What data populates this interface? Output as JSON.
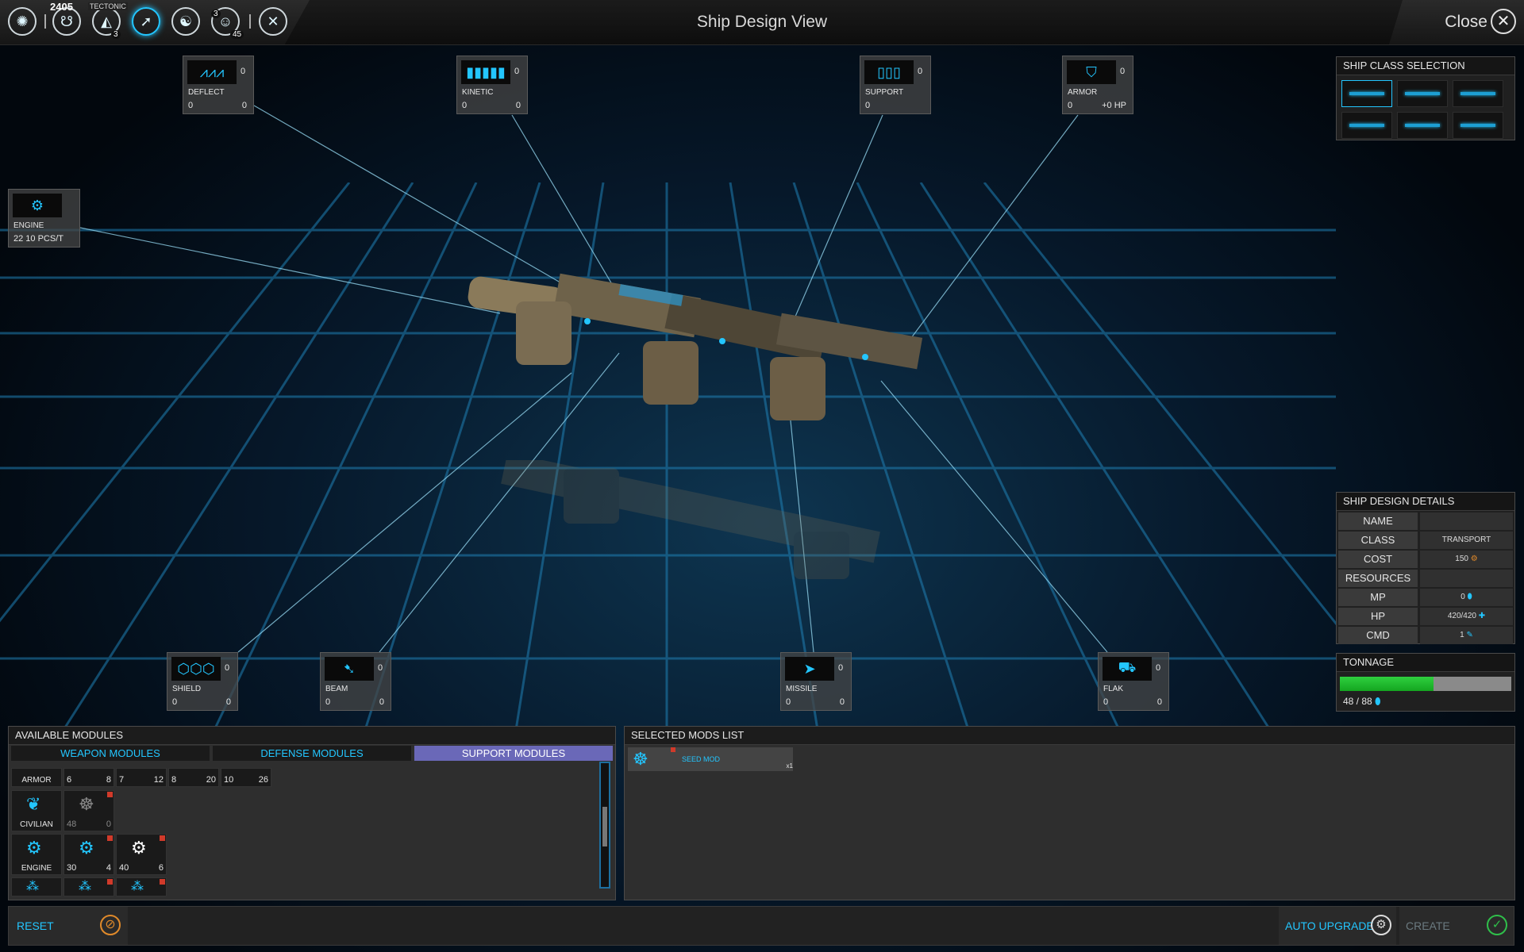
{
  "topbar": {
    "title": "Ship Design View",
    "credits": "2405",
    "planet_label": "TECTONIC",
    "badge_1": "3",
    "badge_2": "3",
    "badge_3": "45",
    "close_label": "Close"
  },
  "slots": {
    "deflect": {
      "name": "DEFLECT",
      "count": "0",
      "stat1": "0",
      "stat2": "0"
    },
    "kinetic": {
      "name": "KINETIC",
      "count": "0",
      "stat1": "0",
      "stat2": "0"
    },
    "support": {
      "name": "SUPPORT",
      "count": "0",
      "stat1": "0"
    },
    "armor": {
      "name": "ARMOR",
      "count": "0",
      "stat1": "0",
      "stat2": "+0 HP"
    },
    "engine": {
      "name": "ENGINE",
      "stat1": "22  10 PCS/T"
    },
    "shield": {
      "name": "SHIELD",
      "count": "0",
      "stat1": "0",
      "stat2": "0"
    },
    "beam": {
      "name": "BEAM",
      "count": "0",
      "stat1": "0",
      "stat2": "0"
    },
    "missile": {
      "name": "MISSILE",
      "count": "0",
      "stat1": "0",
      "stat2": "0"
    },
    "flak": {
      "name": "FLAK",
      "count": "0",
      "stat1": "0",
      "stat2": "0"
    }
  },
  "ship_class": {
    "title": "SHIP CLASS SELECTION"
  },
  "details": {
    "title": "SHIP DESIGN DETAILS",
    "rows": [
      {
        "k": "NAME",
        "v": ""
      },
      {
        "k": "CLASS",
        "v": "TRANSPORT"
      },
      {
        "k": "COST",
        "v": "150"
      },
      {
        "k": "RESOURCES",
        "v": ""
      },
      {
        "k": "MP",
        "v": "0"
      },
      {
        "k": "HP",
        "v": "420/420"
      },
      {
        "k": "CMD",
        "v": "1"
      }
    ]
  },
  "tonnage": {
    "title": "TONNAGE",
    "label": "48 / 88",
    "fill_fraction": 0.545
  },
  "modules": {
    "title": "AVAILABLE MODULES",
    "tabs": [
      "WEAPON MODULES",
      "DEFENSE MODULES",
      "SUPPORT MODULES"
    ],
    "armor_label": "ARMOR",
    "armor_values": [
      {
        "l": "6",
        "r": "8"
      },
      {
        "l": "7",
        "r": "12"
      },
      {
        "l": "8",
        "r": "20"
      },
      {
        "l": "10",
        "r": "26"
      }
    ],
    "civilian_label": "CIVILIAN",
    "civilian_values": {
      "l": "48",
      "r": "0"
    },
    "engine_label": "ENGINE",
    "engine_values": [
      {
        "l": "30",
        "r": "4"
      },
      {
        "l": "40",
        "r": "6"
      }
    ]
  },
  "selected": {
    "title": "SELECTED MODS LIST",
    "item_name": "SEED MOD",
    "item_qty": "x1"
  },
  "footer": {
    "reset": "RESET",
    "auto_upgrade": "AUTO UPGRADE",
    "create": "CREATE"
  }
}
